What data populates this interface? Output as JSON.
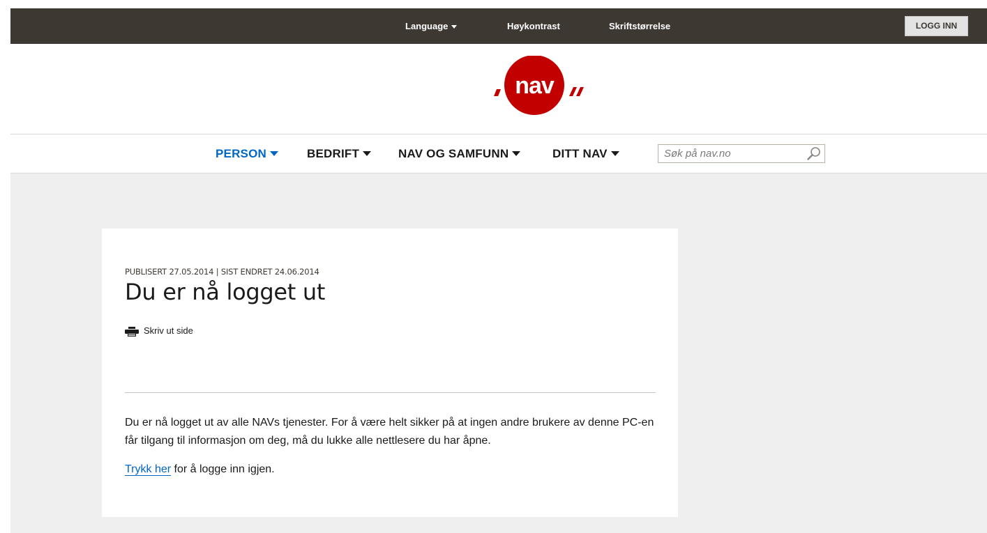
{
  "topbar": {
    "language_label": "Language",
    "high_contrast_label": "Høykontrast",
    "font_size_label": "Skriftstørrelse",
    "login_button_label": "LOGG INN"
  },
  "logo": {
    "text": "nav",
    "brand_color": "#c30000"
  },
  "nav": {
    "items": [
      {
        "label": "PERSON",
        "active": true
      },
      {
        "label": "BEDRIFT",
        "active": false
      },
      {
        "label": "NAV OG SAMFUNN",
        "active": false
      },
      {
        "label": "DITT NAV",
        "active": false
      }
    ],
    "active_color": "#0067c5",
    "search": {
      "placeholder": "Søk på nav.no",
      "value": "",
      "icon": "search-icon"
    }
  },
  "article": {
    "meta": "PUBLISERT 27.05.2014 | SIST ENDRET 24.06.2014",
    "title": "Du er nå logget ut",
    "print_label": "Skriv ut side",
    "print_icon": "printer-icon",
    "body": "Du er nå logget ut av alle NAVs tjenester. For å være helt sikker på at ingen andre brukere av denne PC-en får tilgang til informasjon om deg, må du lukke alle nettlesere du har åpne.",
    "relogin_link": "Trykk her",
    "relogin_rest": " for å logge inn igjen."
  },
  "colors": {
    "topbar_bg": "#3e3832",
    "content_bg": "#efefef",
    "link": "#0067c5"
  }
}
